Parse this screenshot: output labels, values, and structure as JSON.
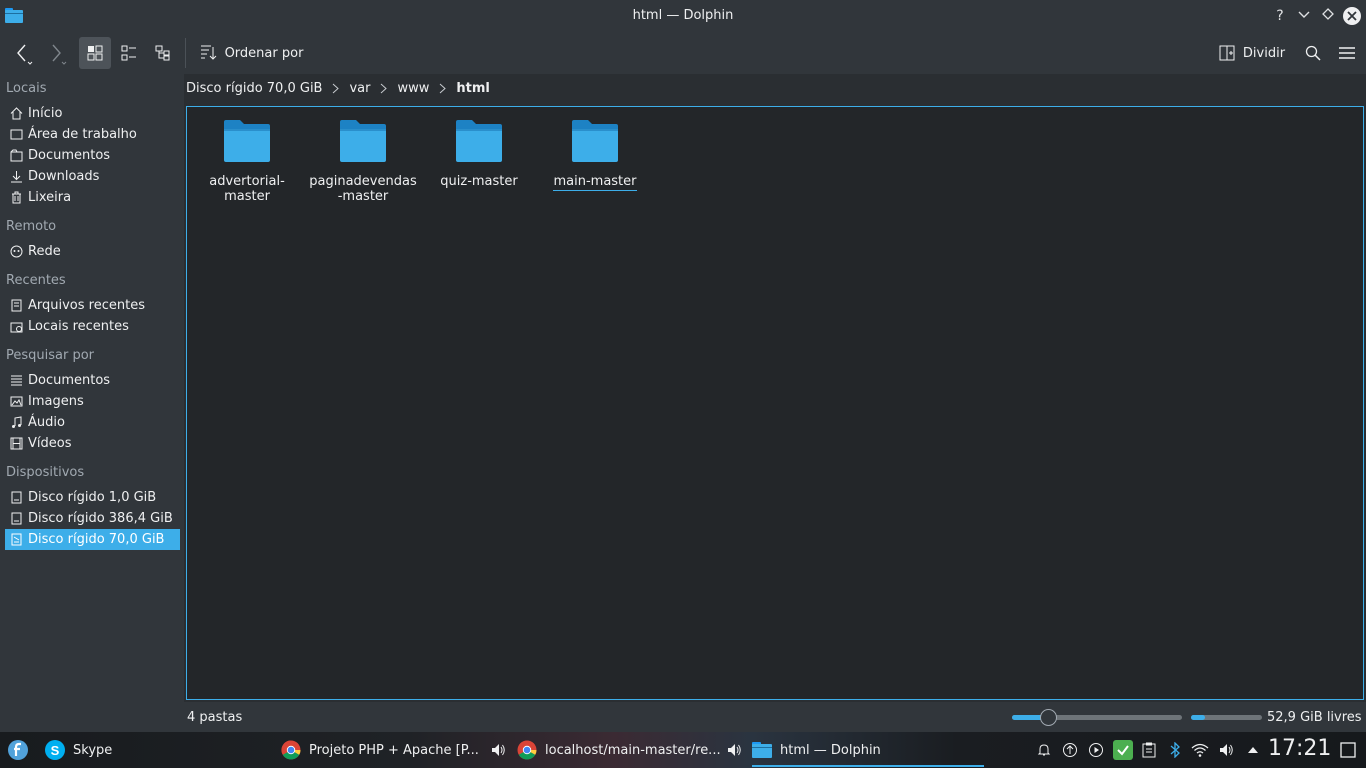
{
  "window": {
    "title": "html — Dolphin",
    "buttons": [
      "help-icon",
      "minimize-icon",
      "keep-above-icon",
      "close-icon"
    ]
  },
  "toolbar": {
    "sort_label": "Ordenar por",
    "split_label": "Dividir"
  },
  "sidebar": {
    "sections": [
      {
        "header": "Locais",
        "items": [
          {
            "label": "Início",
            "icon": "home-icon"
          },
          {
            "label": "Área de trabalho",
            "icon": "desktop-icon"
          },
          {
            "label": "Documentos",
            "icon": "documents-icon"
          },
          {
            "label": "Downloads",
            "icon": "download-icon"
          },
          {
            "label": "Lixeira",
            "icon": "trash-icon"
          }
        ]
      },
      {
        "header": "Remoto",
        "items": [
          {
            "label": "Rede",
            "icon": "network-icon"
          }
        ]
      },
      {
        "header": "Recentes",
        "items": [
          {
            "label": "Arquivos recentes",
            "icon": "recent-files-icon"
          },
          {
            "label": "Locais recentes",
            "icon": "recent-places-icon"
          }
        ]
      },
      {
        "header": "Pesquisar por",
        "items": [
          {
            "label": "Documentos",
            "icon": "text-document-icon"
          },
          {
            "label": "Imagens",
            "icon": "image-icon"
          },
          {
            "label": "Áudio",
            "icon": "audio-icon"
          },
          {
            "label": "Vídeos",
            "icon": "video-icon"
          }
        ]
      },
      {
        "header": "Dispositivos",
        "items": [
          {
            "label": "Disco rígido 1,0 GiB",
            "icon": "drive-icon"
          },
          {
            "label": "Disco rígido 386,4 GiB",
            "icon": "drive-icon"
          },
          {
            "label": "Disco rígido 70,0 GiB",
            "icon": "drive-icon",
            "selected": true
          }
        ]
      }
    ]
  },
  "breadcrumb": [
    "Disco rígido 70,0 GiB",
    "var",
    "www",
    "html"
  ],
  "files": [
    {
      "name_line1": "advertorial-",
      "name_line2": "master"
    },
    {
      "name_line1": "paginadevendas",
      "name_line2": "-master"
    },
    {
      "name_line1": "quiz-master",
      "name_line2": ""
    },
    {
      "name_line1": "main-master",
      "name_line2": "",
      "focused": true
    }
  ],
  "statusbar": {
    "item_count": "4 pastas",
    "free_space": "52,9 GiB livres",
    "zoom_level_fraction": 0.21,
    "used_space_fraction": 0.2
  },
  "taskbar": {
    "tasks": [
      {
        "label": "Skype",
        "icon": "skype-icon"
      },
      {
        "label": "Projeto PHP + Apache [P...",
        "icon": "chrome-icon"
      },
      {
        "label": "localhost/main-master/re...",
        "icon": "chrome-icon"
      },
      {
        "label": "html — Dolphin",
        "icon": "dolphin-icon"
      }
    ],
    "clock": "17:21"
  },
  "colors": {
    "accent": "#3daee9",
    "background": "#2a2e32",
    "view_background": "#232629",
    "text": "#eff0f1"
  }
}
